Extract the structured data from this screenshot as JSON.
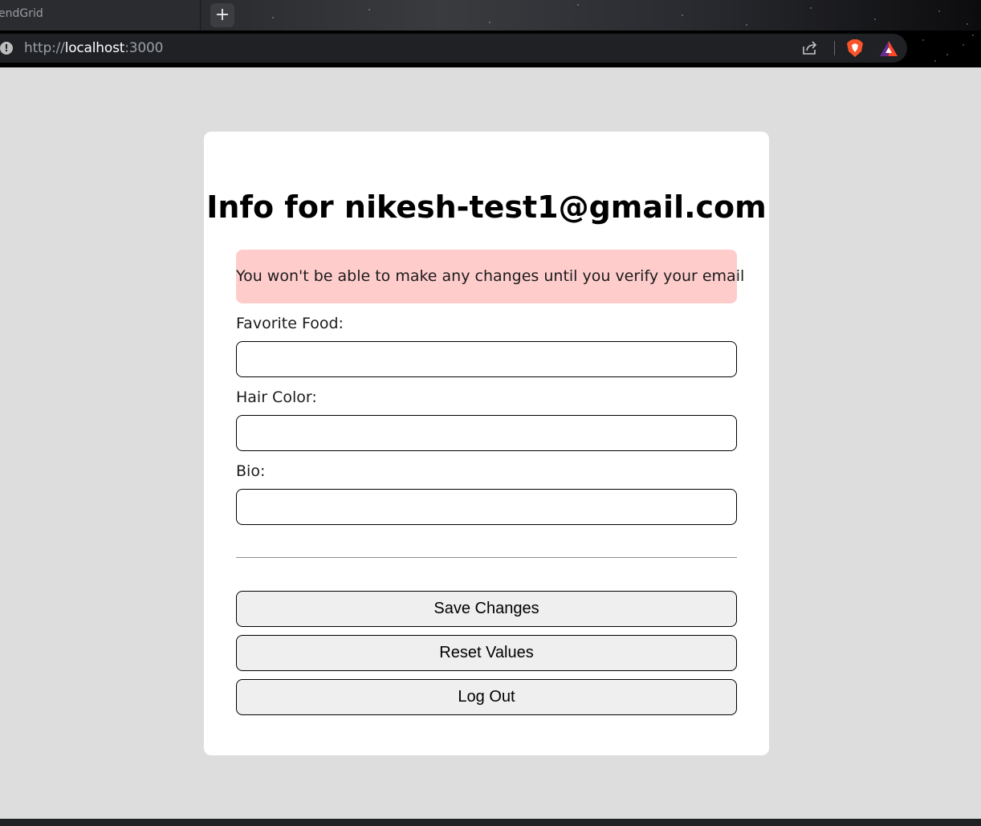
{
  "browser": {
    "tab_title": "endGrid",
    "new_tab_label": "+",
    "url_scheme": "http://",
    "url_host": "localhost",
    "url_port": ":3000",
    "info_icon": "info-icon"
  },
  "page": {
    "title": "Info for nikesh-test1@gmail.com",
    "alert": "You won't be able to make any changes until you verify your email",
    "fields": [
      {
        "label": "Favorite Food:",
        "value": ""
      },
      {
        "label": "Hair Color:",
        "value": ""
      },
      {
        "label": "Bio:",
        "value": ""
      }
    ],
    "buttons": {
      "save": "Save Changes",
      "reset": "Reset Values",
      "logout": "Log Out"
    }
  },
  "colors": {
    "page_bg": "#dddddd",
    "card_bg": "#ffffff",
    "alert_bg": "#ffcccc",
    "button_bg": "#efefef"
  }
}
